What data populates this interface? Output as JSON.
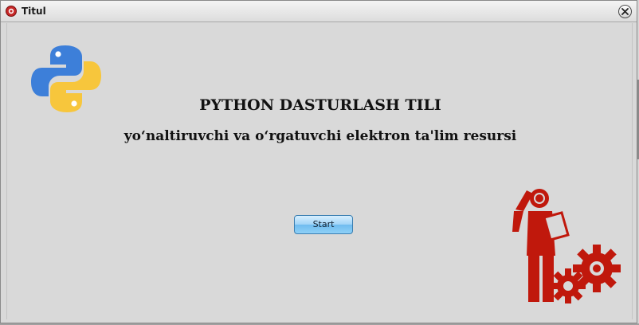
{
  "window": {
    "title": "Titul",
    "close_icon": "close-icon"
  },
  "content": {
    "heading": "PYTHON DASTURLASH TILI",
    "subheading": "yo‘naltiruvchi va o‘rgatuvchi elektron ta'lim resursi",
    "start_button": "Start"
  },
  "icons": {
    "logo": "python-logo-icon",
    "engineer": "engineer-gears-icon"
  },
  "colors": {
    "python_blue": "#3d7fd9",
    "python_yellow": "#f7c63c",
    "engineer_red": "#c0180c",
    "button_blue": "#8fd0f7"
  }
}
